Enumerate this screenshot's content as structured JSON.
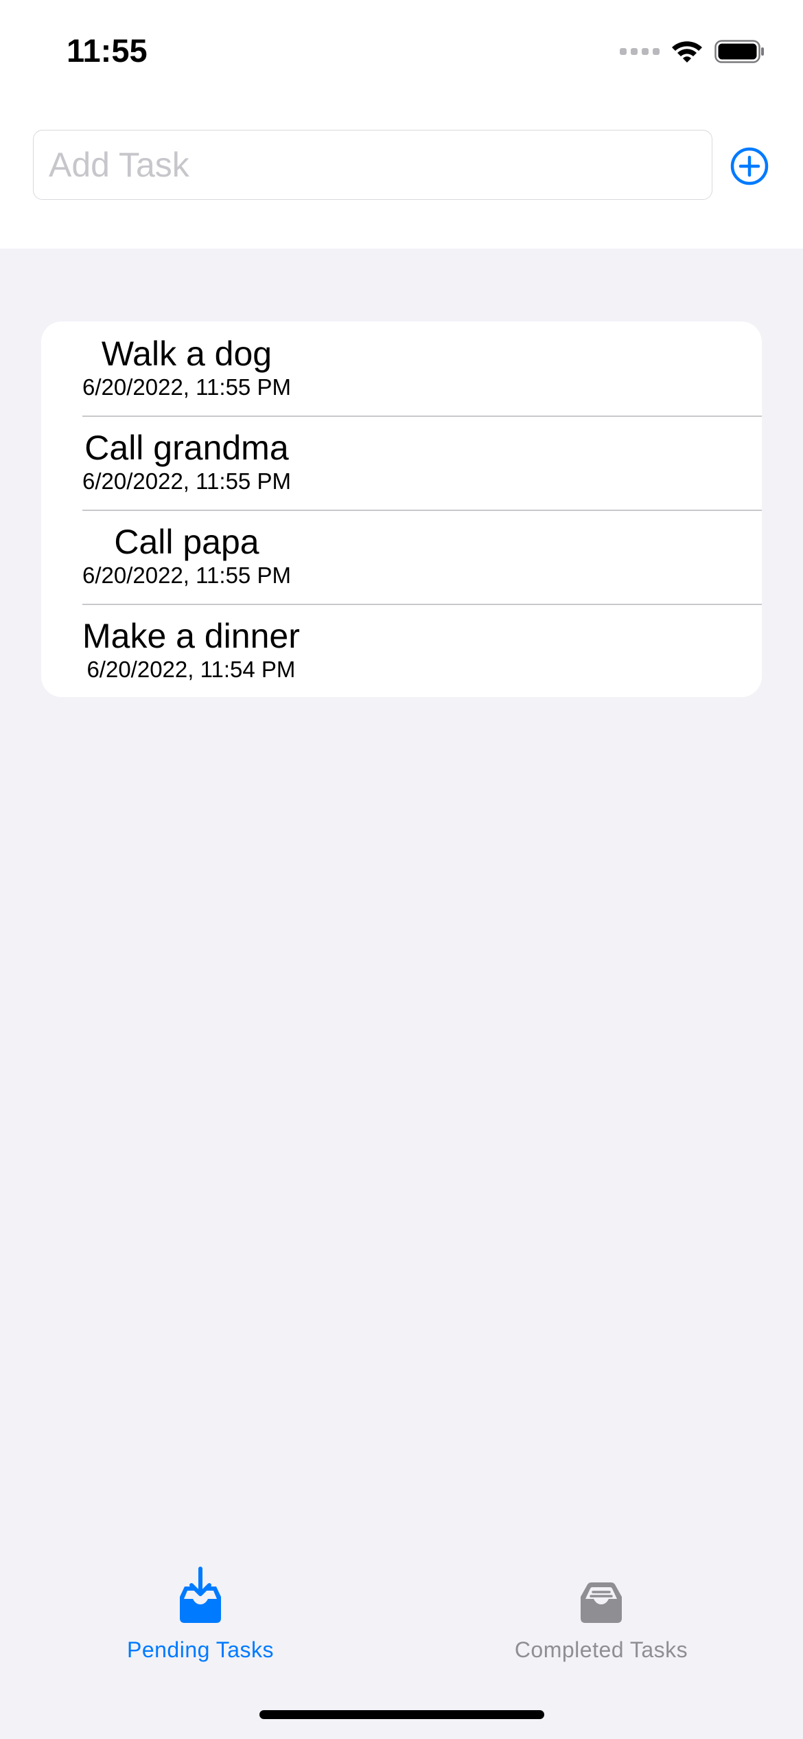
{
  "status_bar": {
    "time": "11:55",
    "icons": [
      "cellular-signal-icon",
      "wifi-icon",
      "battery-icon"
    ]
  },
  "add_task": {
    "placeholder": "Add Task",
    "value": "",
    "add_button_icon": "plus-circle-icon"
  },
  "tasks": [
    {
      "title": "Walk a dog",
      "date": "6/20/2022, 11:55 PM"
    },
    {
      "title": "Call grandma",
      "date": "6/20/2022, 11:55 PM"
    },
    {
      "title": "Call papa",
      "date": "6/20/2022, 11:55 PM"
    },
    {
      "title": "Make a dinner",
      "date": "6/20/2022, 11:54 PM"
    }
  ],
  "tab_bar": {
    "tabs": [
      {
        "label": "Pending Tasks",
        "icon": "tray-arrow-down-icon",
        "selected": true
      },
      {
        "label": "Completed Tasks",
        "icon": "tray-full-icon",
        "selected": false
      }
    ]
  },
  "colors": {
    "accent": "#007AFF",
    "background": "#F2F2F7",
    "inactive": "#8E8E93"
  }
}
